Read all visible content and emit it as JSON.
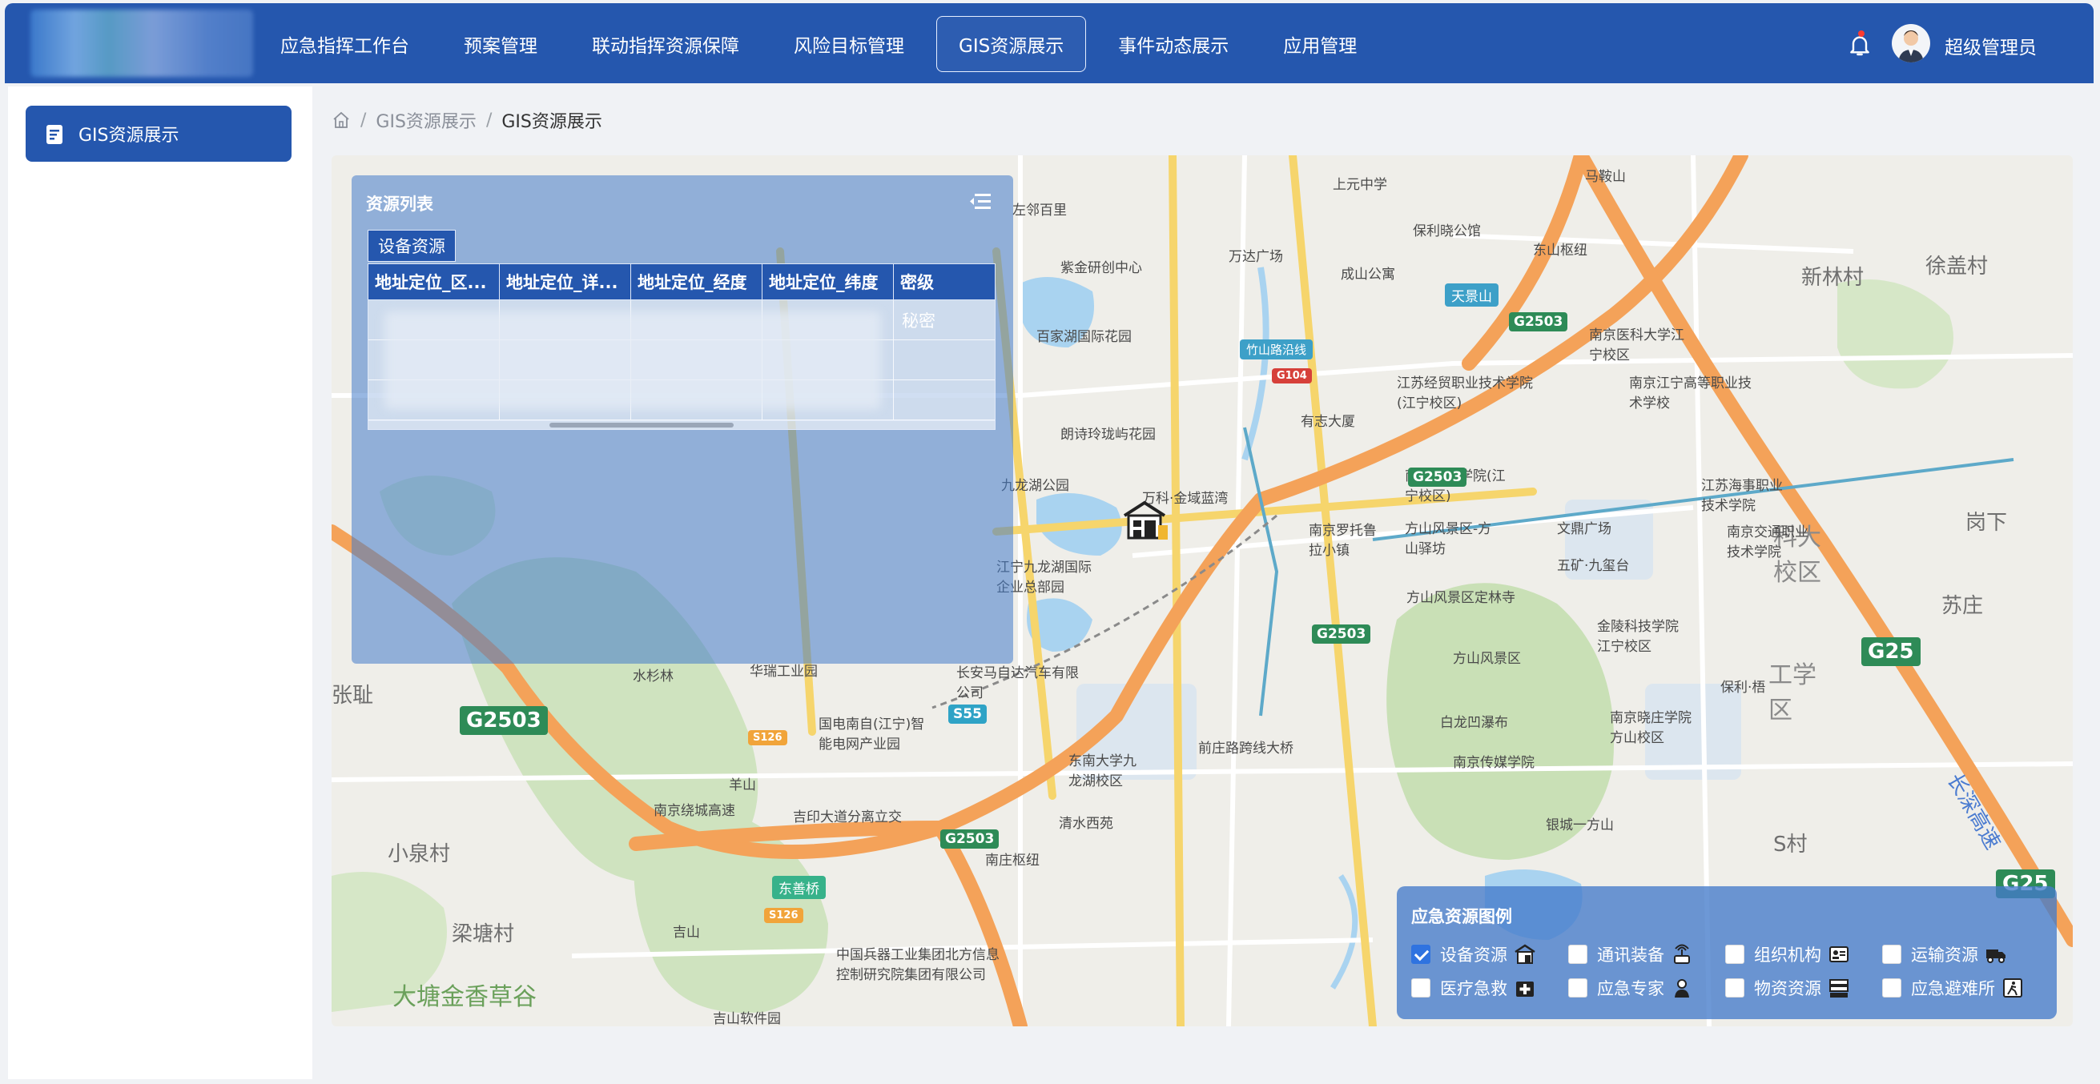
{
  "header": {
    "nav": [
      {
        "label": "应急指挥工作台",
        "active": false
      },
      {
        "label": "预案管理",
        "active": false
      },
      {
        "label": "联动指挥资源保障",
        "active": false
      },
      {
        "label": "风险目标管理",
        "active": false
      },
      {
        "label": "GIS资源展示",
        "active": true
      },
      {
        "label": "事件动态展示",
        "active": false
      },
      {
        "label": "应用管理",
        "active": false
      }
    ],
    "user_name": "超级管理员",
    "icons": [
      "bell-icon",
      "avatar"
    ]
  },
  "sidebar": {
    "items": [
      {
        "label": "GIS资源展示",
        "icon": "document-icon",
        "active": true
      }
    ]
  },
  "breadcrumb": {
    "home_icon": "home-icon",
    "items": [
      "GIS资源展示",
      "GIS资源展示"
    ]
  },
  "resource_panel": {
    "title": "资源列表",
    "tab": "设备资源",
    "columns": [
      "地址定位_区...",
      "地址定位_详...",
      "地址定位_经度",
      "地址定位_纬度",
      "密级"
    ],
    "rows": [
      {
        "classification": "秘密"
      },
      {
        "classification": ""
      },
      {
        "classification": ""
      }
    ]
  },
  "legend": {
    "title": "应急资源图例",
    "items": [
      {
        "label": "设备资源",
        "checked": true,
        "icon": "warehouse-icon"
      },
      {
        "label": "通讯装备",
        "checked": false,
        "icon": "antenna-icon"
      },
      {
        "label": "组织机构",
        "checked": false,
        "icon": "id-card-icon"
      },
      {
        "label": "运输资源",
        "checked": false,
        "icon": "truck-icon"
      },
      {
        "label": "医疗急救",
        "checked": false,
        "icon": "medical-kit-icon"
      },
      {
        "label": "应急专家",
        "checked": false,
        "icon": "expert-icon"
      },
      {
        "label": "物资资源",
        "checked": false,
        "icon": "supplies-icon"
      },
      {
        "label": "应急避难所",
        "checked": false,
        "icon": "shelter-exit-icon"
      }
    ]
  },
  "map": {
    "labels": {
      "l1": "马鞍山",
      "l2": "上元中学",
      "l3": "左邻百里",
      "l4": "紫金研创中心",
      "l5": "万达广场",
      "l6": "成山公寓",
      "l7": "保利晓公馆",
      "l8": "东山枢纽",
      "l9": "天景山",
      "l10": "新林村",
      "l11": "徐盖村",
      "l12": "百家湖国际花园",
      "l13": "南京医科大学江宁校区",
      "l14": "江苏经贸职业技术学院(江宁校区)",
      "l15": "南京江宁高等职业技术学校",
      "l16": "有志大厦",
      "l17": "朗诗玲珑屿花园",
      "l18": "九龙湖公园",
      "l19": "万科·金域蓝湾",
      "l20": "南京工程学院(江宁校区)",
      "l21": "江苏海事职业技术学院",
      "l22": "南京罗托鲁拉小镇",
      "l23": "方山风景区-方山驿坊",
      "l24": "文鼎广场",
      "l25": "五矿·九玺台",
      "l26": "科大校区",
      "l27": "岗下",
      "l28": "江宁九龙湖国际企业总部园",
      "l29": "方山风景区定林寺",
      "l30": "金陵科技学院江宁校区",
      "l31": "苏庄",
      "l32": "方山风景区",
      "l33": "南京交通职业技术学院",
      "l34": "长安马自达汽车有限公司",
      "l35": "华瑞工业园",
      "l36": "水杉林",
      "l37": "张耻",
      "l38": "国电南自(江宁)智能电网产业园",
      "l39": "东南大学九龙湖校区",
      "l40": "前庄路跨线大桥",
      "l41": "白龙凹瀑布",
      "l42": "南京晓庄学院方山校区",
      "l43": "保利·梧",
      "l44": "工学区",
      "l45": "南京传媒学院",
      "l46": "羊山",
      "l47": "南京绕城高速",
      "l48": "吉印大道分离立交",
      "l49": "清水西苑",
      "l50": "银城一方山",
      "l51": "小泉村",
      "l52": "南庄枢纽",
      "l53": "东善桥",
      "l54": "吉山",
      "l55": "梁塘村",
      "l56": "中国兵器工业集团北方信息控制研究院集团有限公司",
      "l57": "大塘金香草谷",
      "l58": "吉山软件园",
      "l59": "长深高速",
      "l60": "S村",
      "l61": "竹山路沿线",
      "r1": "G2503",
      "r2": "G25",
      "r3": "G104",
      "r4": "S55",
      "r5": "S126"
    }
  }
}
